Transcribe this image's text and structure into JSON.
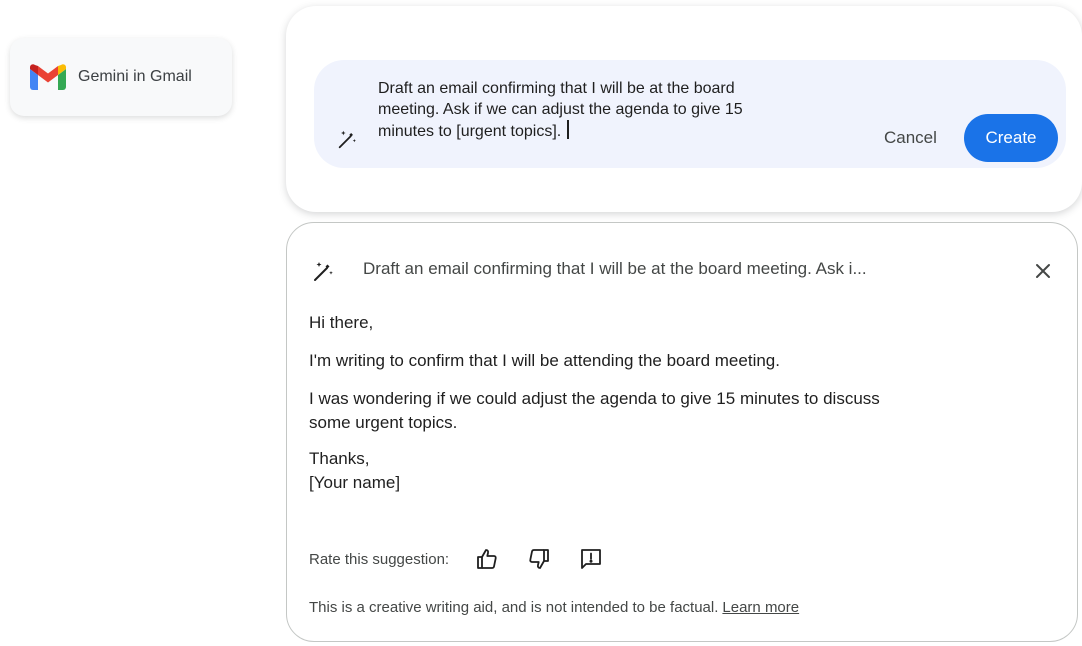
{
  "badge": {
    "logo_icon": "gmail-logo-icon",
    "label": "Gemini in Gmail"
  },
  "prompt": {
    "icon": "magic-wand-icon",
    "line1": "Draft an email confirming that I will be at the board",
    "line2": "meeting. Ask if we can adjust the agenda to give 15",
    "line3": "minutes to [urgent topics].",
    "cancel_label": "Cancel",
    "create_label": "Create",
    "accent": "#1a73e8"
  },
  "result": {
    "icon": "magic-wand-icon",
    "title": "Draft an email confirming that I will be at the board meeting. Ask i...",
    "close_icon": "close-icon",
    "greeting": "Hi there,",
    "para1": "I'm writing to confirm that I will be attending the board meeting.",
    "para2_line1": "I was wondering if we could adjust the agenda to give 15 minutes to discuss",
    "para2_line2": "some urgent topics.",
    "closing": "Thanks,",
    "signature": "[Your name]",
    "rate_label": "Rate this suggestion:",
    "rate_icons": [
      "thumbs-up-icon",
      "thumbs-down-icon",
      "report-icon"
    ],
    "disclaimer": "This is a creative writing aid, and is not intended to be factual.",
    "learn_more": "Learn more"
  }
}
